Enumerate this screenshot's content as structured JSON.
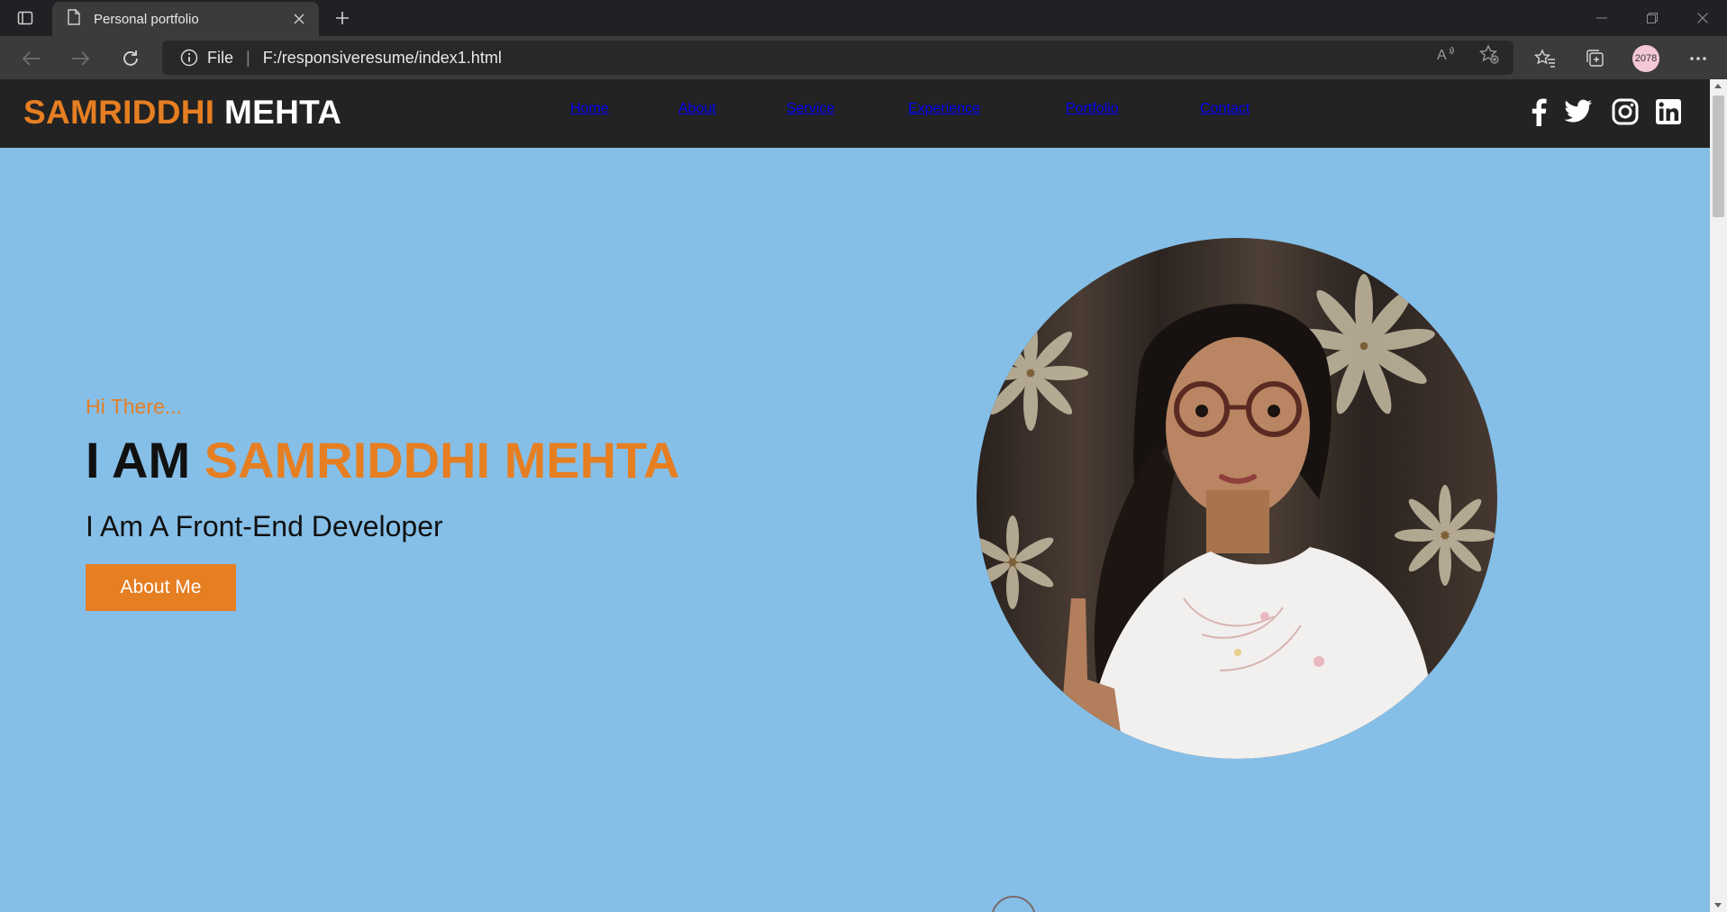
{
  "browser": {
    "tab_title": "Personal portfolio",
    "scheme_label": "File",
    "url": "F:/responsiveresume/index1.html",
    "profile_badge": "2078"
  },
  "site": {
    "logo_first": "SAMRIDDHI",
    "logo_last": "MEHTA",
    "nav": [
      "Home",
      "About",
      "Service",
      "Experience",
      "Portfolio",
      "Contact"
    ],
    "social_icons": [
      "facebook-icon",
      "twitter-icon",
      "instagram-icon",
      "linkedin-icon"
    ]
  },
  "hero": {
    "greeting": "Hi There...",
    "headline_prefix": "I AM",
    "headline_name": "SAMRIDDHI MEHTA",
    "subtitle": "I Am A Front-End Developer",
    "cta_label": "About Me"
  },
  "colors": {
    "accent": "#e67e22",
    "hero_bg": "#85bfe8",
    "header_bg": "#232323"
  }
}
